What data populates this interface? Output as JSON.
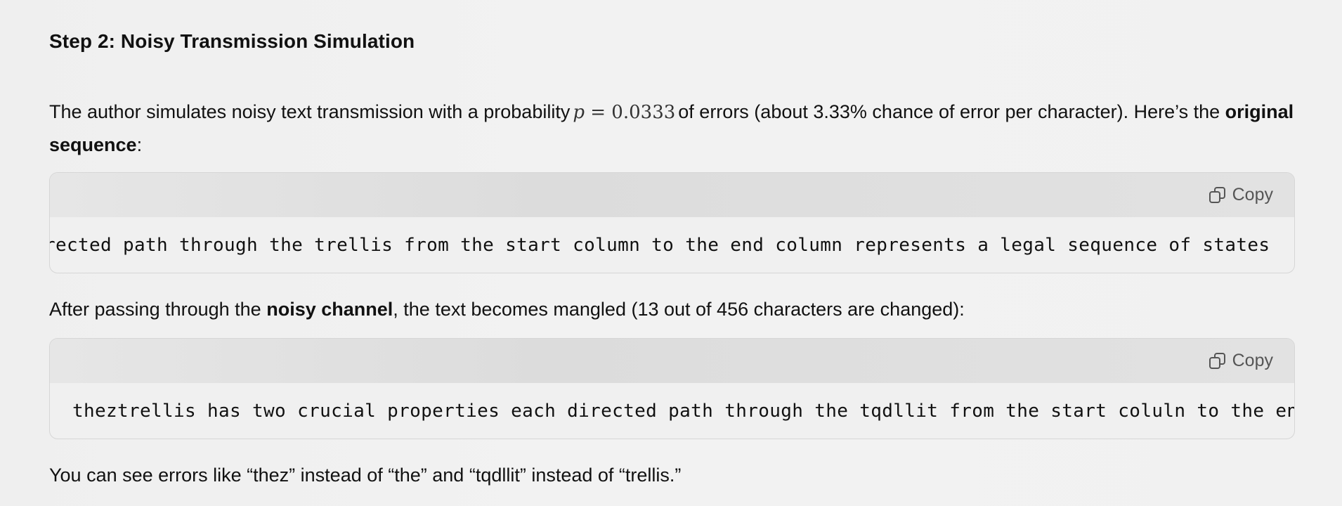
{
  "heading": "Step 2: Noisy Transmission Simulation",
  "para1": {
    "part1": "The author simulates noisy text transmission with a probability",
    "math_var": "p",
    "math_rest": "= 0.0333",
    "part2": "of errors (about 3.33% chance of error per character). Here’s the",
    "bold": "original sequence",
    "part3": ":"
  },
  "code1": {
    "copy_label": "Copy",
    "text": "rected path through the trellis from the start column to the end column represents a legal sequence of states"
  },
  "para2": {
    "part1": "After passing through the",
    "bold": "noisy channel",
    "part2": ", the text becomes mangled (13 out of 456 characters are changed):"
  },
  "code2": {
    "copy_label": "Copy",
    "text": "theztrellis has two crucial properties each directed path through the tqdllit from the start coluln to the en"
  },
  "para3": "You can see errors like “thez” instead of “the” and “tqdllit” instead of “trellis.”",
  "icons": {
    "copy": "copy-icon"
  }
}
